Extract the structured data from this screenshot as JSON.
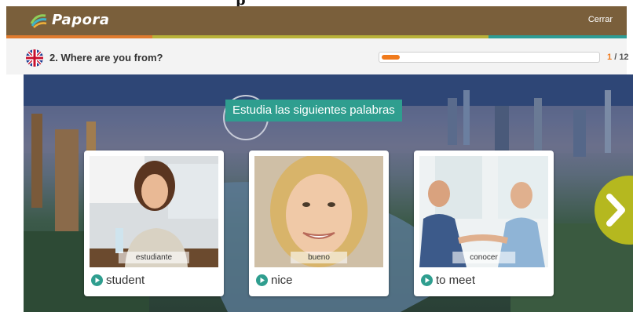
{
  "app": {
    "name": "Papora",
    "close_label": "Cerrar"
  },
  "colors": {
    "header": "#7a5f3b",
    "accent_orange": "#f07a1c",
    "accent_olive": "#b9b23a",
    "accent_teal": "#2e9c94",
    "banner": "#2f9e8f",
    "next_button": "#b5b81f"
  },
  "lesson": {
    "title": "2. Where are you from?",
    "language_flag": "united-kingdom-flag-icon",
    "progress": {
      "current": "1",
      "separator": "/",
      "total": "12"
    }
  },
  "exercise": {
    "instruction": "Estudia las siguientes palabras",
    "cards": [
      {
        "caption": "estudiante",
        "word": "student",
        "icon": "play-icon"
      },
      {
        "caption": "bueno",
        "word": "nice",
        "icon": "play-icon"
      },
      {
        "caption": "conocer",
        "word": "to meet",
        "icon": "play-icon"
      }
    ],
    "next_icon": "chevron-right-icon"
  }
}
